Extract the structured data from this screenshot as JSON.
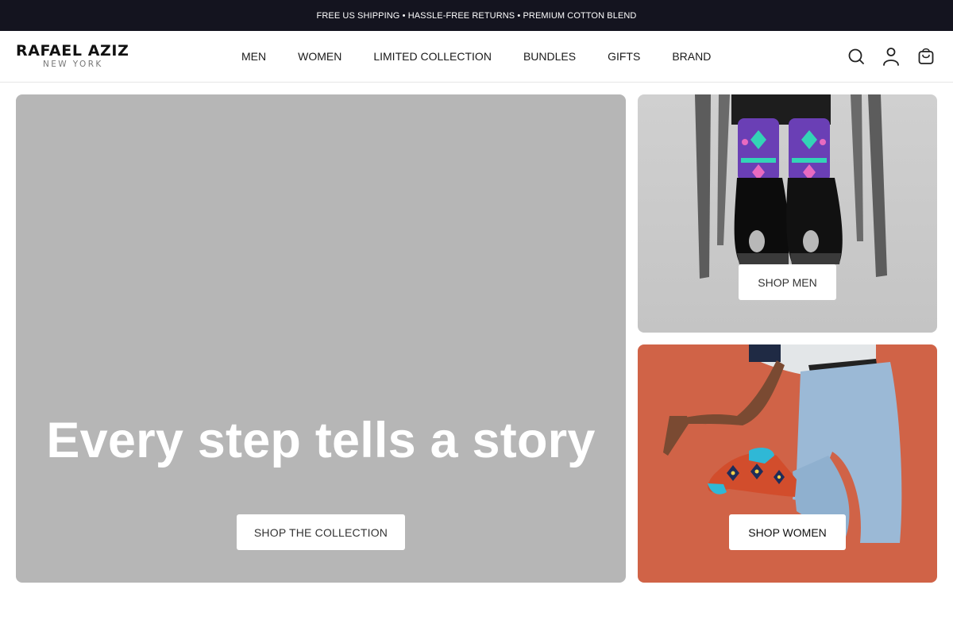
{
  "announcement": "FREE US SHIPPING • HASSLE-FREE RETURNS • PREMIUM COTTON BLEND",
  "brand": {
    "name": "RAFAEL AZIZ",
    "location": "NEW YORK"
  },
  "nav": [
    "MEN",
    "WOMEN",
    "LIMITED COLLECTION",
    "BUNDLES",
    "GIFTS",
    "BRAND"
  ],
  "header_icons": [
    "search-icon",
    "account-icon",
    "cart-icon"
  ],
  "hero": {
    "title": "Every step tells a story",
    "cta": "SHOP THE COLLECTION"
  },
  "cards": {
    "men": {
      "cta": "SHOP MEN"
    },
    "women": {
      "cta": "SHOP WOMEN"
    }
  },
  "colors": {
    "announcement_bg": "#14141f",
    "hero_bg": "#b6b6b6",
    "women_bg": "#d06347",
    "men_bg": "#c8c8c8"
  }
}
